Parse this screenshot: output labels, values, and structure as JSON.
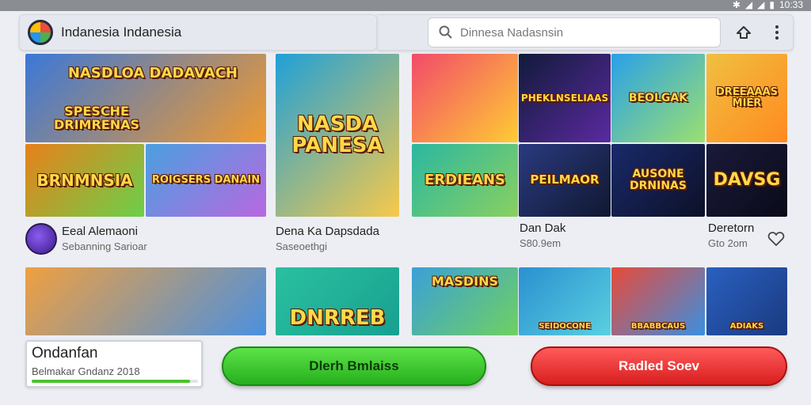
{
  "status_bar": {
    "time": "10:33"
  },
  "app": {
    "title": "Indanesia Indanesia"
  },
  "search": {
    "placeholder": "Dinnesa Nadasnsin"
  },
  "tiles": [
    {
      "text": "NASDLOA DADAVACH",
      "colors": [
        "#3a78d8",
        "#f29a2e"
      ]
    },
    {
      "text": "SPESCHE DRIMRENAS",
      "colors": [
        "#1e6fd0",
        "#6ad05a"
      ]
    },
    {
      "text": "NASDA PANESA",
      "colors": [
        "#1fa0d8",
        "#f7c94a"
      ]
    },
    {
      "text": "",
      "colors": [
        "#f24a6a",
        "#ffcc33"
      ]
    },
    {
      "text": "PHEKLNSELIAAS",
      "colors": [
        "#121a3a",
        "#5a2aa0"
      ]
    },
    {
      "text": "BEOLGAK",
      "colors": [
        "#2aa0e8",
        "#9be070"
      ]
    },
    {
      "text": "DREEAAAS MIER",
      "colors": [
        "#f0c040",
        "#ff8a20"
      ]
    },
    {
      "text": "BRNMNSIA",
      "colors": [
        "#e8801a",
        "#6bd04a"
      ]
    },
    {
      "text": "ROIGSERS DANAIN",
      "colors": [
        "#4aa0e0",
        "#b868e0"
      ]
    },
    {
      "text": "",
      "colors": [
        "#e24a2a",
        "#6a3a9a"
      ]
    },
    {
      "text": "ERDIEANS",
      "colors": [
        "#2ab8a0",
        "#8ad060"
      ]
    },
    {
      "text": "PEILMAOR",
      "colors": [
        "#2a3a80",
        "#101830"
      ]
    },
    {
      "text": "AUSONE DRNINAS",
      "colors": [
        "#1a2a6a",
        "#0c1028"
      ]
    },
    {
      "text": "DAVSG",
      "colors": [
        "#1a1a3a",
        "#0a0a1a"
      ]
    },
    {
      "text": "",
      "colors": [
        "#f0a040",
        "#4a90e0"
      ]
    },
    {
      "text": "DNRREB",
      "colors": [
        "#2ac0a0",
        "#18a090"
      ]
    },
    {
      "text": "MASDINS",
      "colors": [
        "#3aa0d8",
        "#70d060"
      ]
    },
    {
      "text": "SEIDOCONE",
      "colors": [
        "#2a90d0",
        "#5ad0e0"
      ]
    },
    {
      "text": "BBABBCAUS",
      "colors": [
        "#e84a3a",
        "#3a90e0"
      ]
    },
    {
      "text": "ADIAKS",
      "colors": [
        "#2a60c0",
        "#1a3a80"
      ]
    }
  ],
  "cards": [
    {
      "title": "Eeal Alemaoni",
      "subtitle": "Sebanning Sarioar"
    },
    {
      "title": "Dena Ka Dapsdada",
      "subtitle": "Saseoethgi"
    },
    {
      "title": "Dan Dak",
      "subtitle": "S80.9em"
    },
    {
      "title": "Deretorn",
      "subtitle": "Gto 2om"
    }
  ],
  "info_card": {
    "title": "Ondanfan",
    "subtitle": "Belmakar Gndanz 2018",
    "progress": 0.95
  },
  "buttons": {
    "green_label": "Dlerh Bmlaiss",
    "red_label": "Radled Soev"
  }
}
